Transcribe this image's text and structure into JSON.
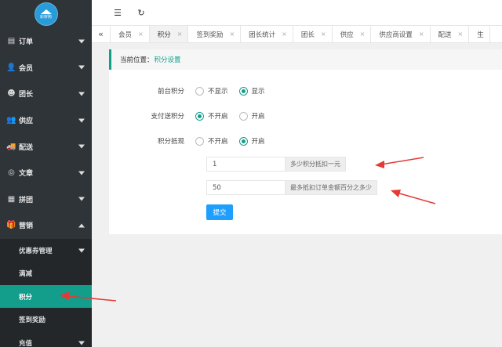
{
  "logo": {
    "text": "彩拼购"
  },
  "sidebar": {
    "items": [
      {
        "label": "订单",
        "icon": "document-icon",
        "glyph": "▤"
      },
      {
        "label": "会员",
        "icon": "user-icon",
        "glyph": "👤"
      },
      {
        "label": "团长",
        "icon": "face-icon",
        "glyph": "☻"
      },
      {
        "label": "供应",
        "icon": "users-icon",
        "glyph": "👥"
      },
      {
        "label": "配送",
        "icon": "truck-icon",
        "glyph": "🚚"
      },
      {
        "label": "文章",
        "icon": "compass-icon",
        "glyph": "◎"
      },
      {
        "label": "拼团",
        "icon": "list-icon",
        "glyph": "▦"
      },
      {
        "label": "营销",
        "icon": "gift-icon",
        "glyph": "🎁"
      }
    ],
    "submenu": [
      {
        "label": "优惠券管理",
        "has_caret": true
      },
      {
        "label": "满减",
        "has_caret": false
      },
      {
        "label": "积分",
        "has_caret": false,
        "active": true
      },
      {
        "label": "签到奖励",
        "has_caret": false
      },
      {
        "label": "充值",
        "has_caret": true
      }
    ]
  },
  "topbar": {
    "collapse_icon": "indent-icon",
    "refresh_icon": "refresh-icon"
  },
  "tabs": [
    {
      "label": "会员",
      "active": false
    },
    {
      "label": "积分",
      "active": true
    },
    {
      "label": "签到奖励",
      "active": false
    },
    {
      "label": "团长统计",
      "active": false
    },
    {
      "label": "团长",
      "active": false
    },
    {
      "label": "供应",
      "active": false
    },
    {
      "label": "供应商设置",
      "active": false
    },
    {
      "label": "配送",
      "active": false
    },
    {
      "label": "生",
      "active": false
    }
  ],
  "breadcrumb": {
    "prefix": "当前位置：",
    "current": "积分设置"
  },
  "form": {
    "rows": [
      {
        "label": "前台积分",
        "options": [
          {
            "text": "不显示",
            "checked": false
          },
          {
            "text": "显示",
            "checked": true
          }
        ]
      },
      {
        "label": "支付送积分",
        "options": [
          {
            "text": "不开启",
            "checked": true
          },
          {
            "text": "开启",
            "checked": false
          }
        ]
      },
      {
        "label": "积分抵现",
        "options": [
          {
            "text": "不开启",
            "checked": false
          },
          {
            "text": "开启",
            "checked": true
          }
        ]
      }
    ],
    "points_per_yuan": {
      "value": "1",
      "addon": "多少积分抵扣一元"
    },
    "max_percent": {
      "value": "50",
      "addon": "最多抵扣订单金额百分之多少"
    },
    "submit_label": "提交"
  },
  "colors": {
    "accent": "#139e8c",
    "button": "#1e9fff",
    "arrow": "#e53935",
    "sidebar": "#2f3438"
  }
}
